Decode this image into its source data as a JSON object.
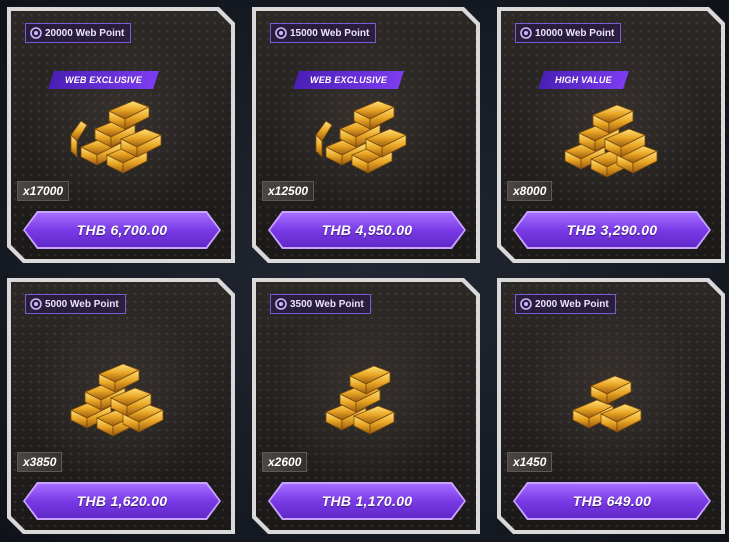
{
  "colors": {
    "accent_purple": "#7d3cf0",
    "button_top": "#a46dff",
    "button_bottom": "#6028c8",
    "card_border": "#d9d9d9",
    "gold": "#e8a524"
  },
  "cards": [
    {
      "web_point": "20000 Web Point",
      "badge": "WEB EXCLUSIVE",
      "quantity": "x17000",
      "price": "THB 6,700.00",
      "art_icon": "gold-bars-icon"
    },
    {
      "web_point": "15000 Web Point",
      "badge": "WEB EXCLUSIVE",
      "quantity": "x12500",
      "price": "THB 4,950.00",
      "art_icon": "gold-bars-icon"
    },
    {
      "web_point": "10000 Web Point",
      "badge": "HIGH VALUE",
      "quantity": "x8000",
      "price": "THB 3,290.00",
      "art_icon": "gold-bars-icon"
    },
    {
      "web_point": "5000 Web Point",
      "badge": "",
      "quantity": "x3850",
      "price": "THB 1,620.00",
      "art_icon": "gold-bars-icon"
    },
    {
      "web_point": "3500 Web Point",
      "badge": "",
      "quantity": "x2600",
      "price": "THB 1,170.00",
      "art_icon": "gold-bars-icon"
    },
    {
      "web_point": "2000 Web Point",
      "badge": "",
      "quantity": "x1450",
      "price": "THB 649.00",
      "art_icon": "gold-bars-icon"
    }
  ]
}
